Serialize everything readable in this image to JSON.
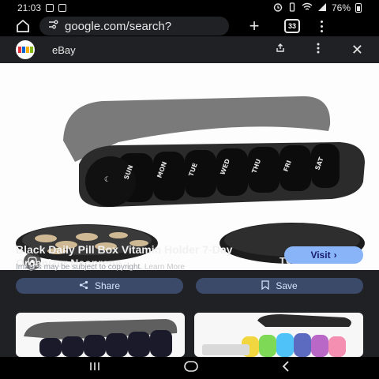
{
  "status_bar": {
    "time": "21:03",
    "battery": "76%"
  },
  "browser": {
    "url": "google.com/search?",
    "tab_count": "33"
  },
  "result": {
    "site_name": "eBay",
    "title": "Black Daily Pill Box Vitamin Holder 7-Day Organizer Neoprene ...",
    "visit_label": "Visit",
    "copyright_text": "Images may be subject to copyright.",
    "learn_more": "Learn More",
    "share_label": "Share",
    "save_label": "Save"
  },
  "product_image": {
    "day_labels": [
      "SUN",
      "MON",
      "TUE",
      "WED",
      "THU",
      "FRI",
      "SAT"
    ],
    "lid_label": "TUE"
  },
  "colors": {
    "panel": "#202124",
    "visit_button": "#8ab4f8",
    "action_button": "#3c4a6a"
  }
}
